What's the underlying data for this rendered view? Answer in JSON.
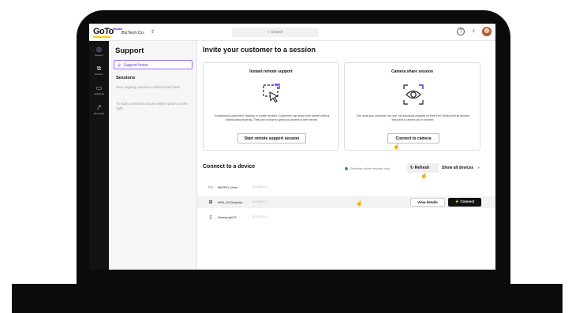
{
  "app": {
    "logo": "GoTo",
    "logo_sub": "Resolve",
    "company": "BizTech Co.",
    "search_placeholder": "Search"
  },
  "rail": {
    "items": [
      {
        "label": "Support",
        "icon": "support-icon"
      },
      {
        "label": "Devices",
        "icon": "devices-icon"
      },
      {
        "label": "Helpdesk",
        "icon": "helpdesk-icon"
      },
      {
        "label": "Reporting",
        "icon": "reporting-icon"
      }
    ]
  },
  "sidebar": {
    "title": "Support",
    "home_label": "Support home",
    "sessions_title": "Sessions",
    "sessions_text1": "Your ongoing sessions will be listed here.",
    "sessions_text2": "To start a session choose either option on the right."
  },
  "main": {
    "title": "Invite your customer to a session",
    "card1": {
      "title": "Instant remote support",
      "desc": "Troubleshoot customers' desktop or mobile devices. Customers can share their screen without downloading anything. They can choose to grant you access to their device.",
      "button": "Start remote support session"
    },
    "card2": {
      "title": "Camera share session",
      "desc": "See what your customer can see. No download required on their end. Works with all devices that have a camera and a browser.",
      "button": "Connect to camera"
    },
    "connect_title": "Connect to a device",
    "online_text": "Showing online devices only",
    "refresh_label": "Refresh",
    "show_all_label": "Show all devices",
    "devices": [
      {
        "name": "MkPRO_Mom",
        "ip": "112.134.0.1",
        "icon": "monitor-icon"
      },
      {
        "name": "WIN_1223Laptop",
        "ip": "112.134.0.1",
        "icon": "windows-icon"
      },
      {
        "name": "Samsung123",
        "ip": "112.134.0.1",
        "icon": "phone-icon"
      }
    ],
    "view_details_label": "View details",
    "connect_label": "Connect"
  },
  "colors": {
    "accent": "#7b2ff7",
    "rail_bg": "#131313",
    "online": "#1fa36b"
  }
}
